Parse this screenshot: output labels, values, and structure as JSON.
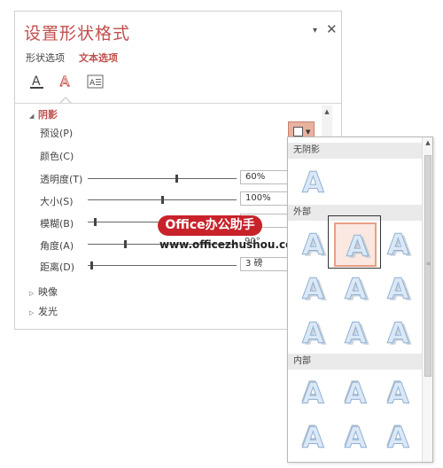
{
  "pane": {
    "title": "设置形状格式",
    "dropdown_glyph": "▾",
    "close_glyph": "✕",
    "tabs": {
      "shape_options": "形状选项",
      "text_options": "文本选项"
    },
    "icons": [
      "text-fill-outline-icon",
      "text-effects-icon",
      "textbox-icon"
    ],
    "accent_color": "#c0504d"
  },
  "shadow": {
    "section_label": "阴影",
    "preset_label": "预设(P)",
    "color_label": "颜色(C)",
    "transparency": {
      "label": "透明度(T)",
      "value": "60%",
      "slider_fraction": 0.6
    },
    "size": {
      "label": "大小(S)",
      "value": "100%",
      "slider_fraction": 0.5
    },
    "blur": {
      "label": "模糊(B)",
      "value": "",
      "slider_fraction": 0.04
    },
    "angle": {
      "label": "角度(A)",
      "value": "90°",
      "slider_fraction": 0.25
    },
    "distance": {
      "label": "距离(D)",
      "value": "3 磅",
      "slider_fraction": 0.02
    }
  },
  "collapsed_sections": {
    "reflection": "映像",
    "glow": "发光"
  },
  "gallery": {
    "headers": {
      "none": "无阴影",
      "outer": "外部",
      "inner": "内部"
    },
    "glyph": "A",
    "selected": "outer-2",
    "up_arrow": "▲",
    "grip": "≡"
  },
  "scroll": {
    "up_arrow": "▲"
  },
  "watermark": {
    "badge": "Office办公助手",
    "url": "www.officezhushou.com"
  }
}
